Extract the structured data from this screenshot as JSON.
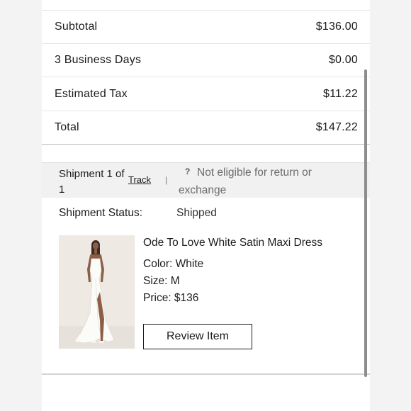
{
  "summary": {
    "rows": [
      {
        "label": "Subtotal",
        "value": "$136.00"
      },
      {
        "label": "3 Business Days",
        "value": "$0.00"
      },
      {
        "label": "Estimated Tax",
        "value": "$11.22"
      },
      {
        "label": "Total",
        "value": "$147.22"
      }
    ]
  },
  "shipment": {
    "title": "Shipment 1 of 1",
    "track_label": "Track",
    "separator": "|",
    "help_icon": "question-mark-icon",
    "help_glyph": "?",
    "return_note": "Not eligible for return or exchange",
    "status_label": "Shipment Status:",
    "status_value": "Shipped"
  },
  "product": {
    "name": "Ode To Love White Satin Maxi Dress",
    "color": "Color: White",
    "size": "Size: M",
    "price": "Price: $136",
    "review_label": "Review Item",
    "image_icon": "dress-photo"
  },
  "colors": {
    "page_bg": "#f3f3f3",
    "card_bg": "#ffffff",
    "shipment_header_bg": "#f1f1f1",
    "text": "#1c1c1c",
    "muted_text": "#6c6c6c",
    "scrollbar": "#8d8d8d"
  }
}
